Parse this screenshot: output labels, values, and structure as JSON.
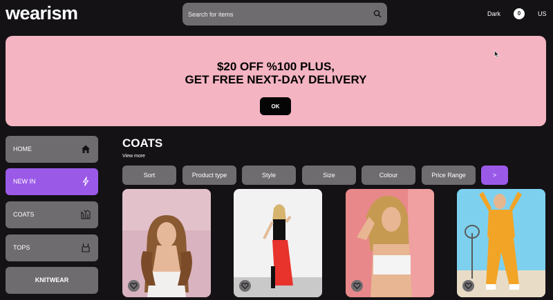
{
  "header": {
    "logo": "wearism",
    "search_placeholder": "Search for items",
    "theme_label": "Dark",
    "cart_count": "0",
    "region": "US"
  },
  "banner": {
    "line1": "$20 OFF %100 PLUS,",
    "line2": "GET FREE NEXT-DAY DELIVERY",
    "ok_label": "OK",
    "background": "#f4b4c2"
  },
  "sidebar": {
    "items": [
      {
        "label": "HOME",
        "icon": "home-icon"
      },
      {
        "label": "NEW IN",
        "icon": "lightning-icon",
        "active": true
      },
      {
        "label": "COATS",
        "icon": "coat-icon"
      },
      {
        "label": "TOPS",
        "icon": "top-icon"
      },
      {
        "label": "KNITWEAR",
        "icon": ""
      }
    ]
  },
  "main": {
    "category_title": "COATS",
    "view_more": "View more",
    "filters": [
      "Sort",
      "Product type",
      "Style",
      "Size",
      "Colour",
      "Price Range",
      ">"
    ],
    "products": [
      {
        "image": "woman-curly-hair-white-top",
        "favorite_icon": "heart-icon"
      },
      {
        "image": "woman-red-skirt-posing",
        "favorite_icon": "heart-icon"
      },
      {
        "image": "woman-white-sports-bra",
        "favorite_icon": "heart-icon"
      },
      {
        "image": "woman-orange-tracksuit",
        "favorite_icon": "heart-icon"
      }
    ]
  },
  "colors": {
    "background": "#141215",
    "panel": "#6e6c6f",
    "accent": "#9b59e8",
    "banner": "#f4b4c2"
  }
}
